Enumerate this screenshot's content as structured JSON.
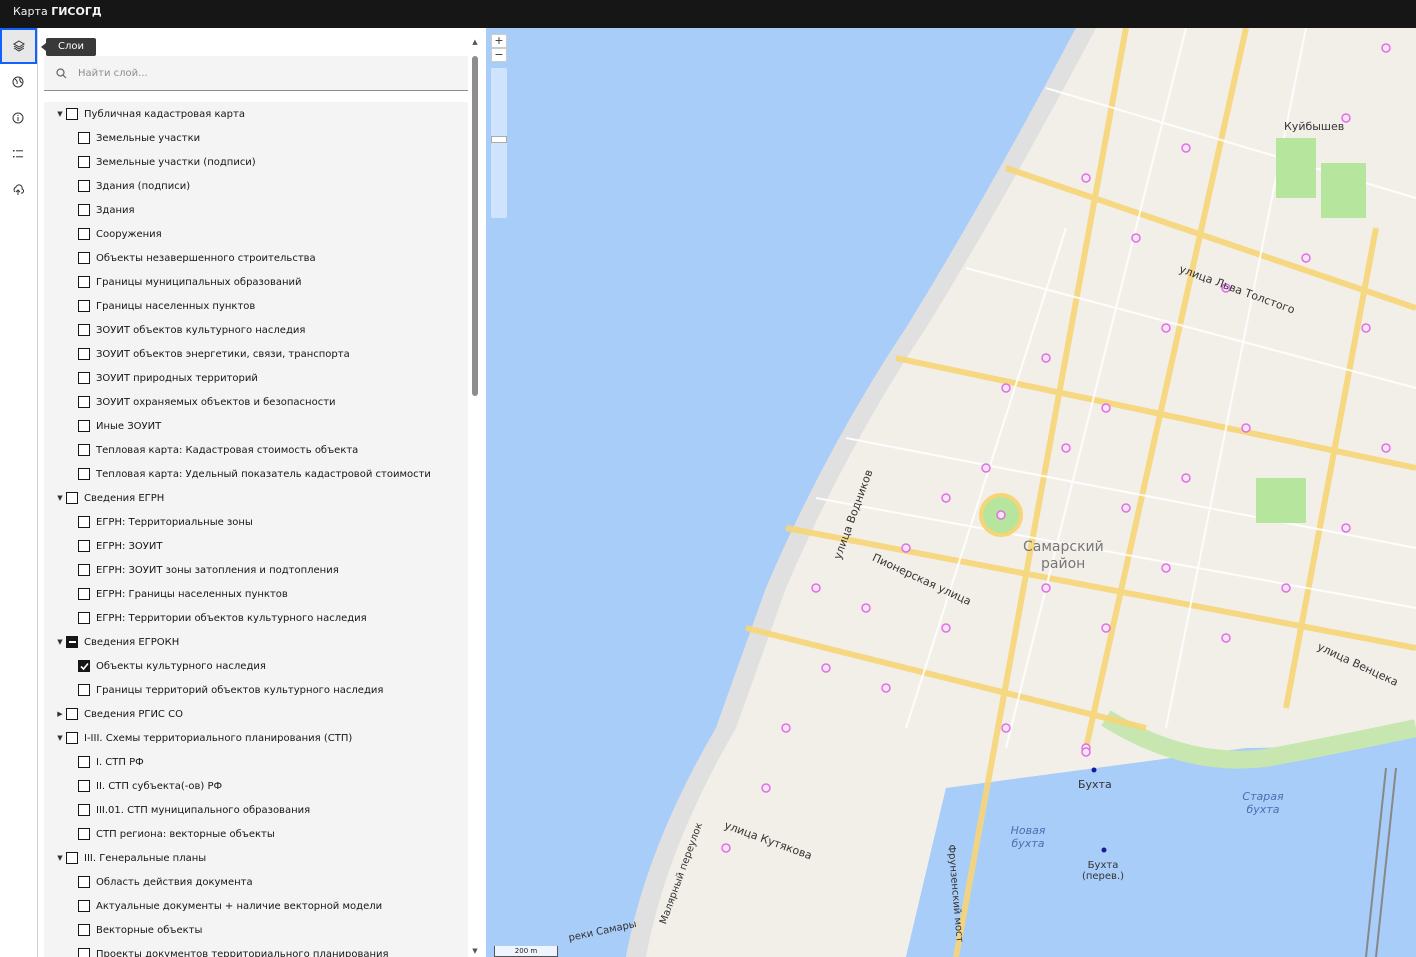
{
  "app": {
    "title_prefix": "Карта",
    "title_name": "ГИСОГД"
  },
  "rail": {
    "tooltip": "Слои",
    "items": [
      {
        "name": "layers-icon"
      },
      {
        "name": "globe-icon"
      },
      {
        "name": "info-icon"
      },
      {
        "name": "list-icon"
      },
      {
        "name": "upload-icon"
      }
    ]
  },
  "search": {
    "placeholder": "Найти слой..."
  },
  "tree": [
    {
      "label": "Публичная кадастровая карта",
      "level": 0,
      "expanded": true,
      "state": "unchecked"
    },
    {
      "label": "Земельные участки",
      "level": 1,
      "state": "unchecked"
    },
    {
      "label": "Земельные участки (подписи)",
      "level": 1,
      "state": "unchecked"
    },
    {
      "label": "Здания (подписи)",
      "level": 1,
      "state": "unchecked"
    },
    {
      "label": "Здания",
      "level": 1,
      "state": "unchecked"
    },
    {
      "label": "Сооружения",
      "level": 1,
      "state": "unchecked"
    },
    {
      "label": "Объекты незавершенного строительства",
      "level": 1,
      "state": "unchecked"
    },
    {
      "label": "Границы муниципальных образований",
      "level": 1,
      "state": "unchecked"
    },
    {
      "label": "Границы населенных пунктов",
      "level": 1,
      "state": "unchecked"
    },
    {
      "label": "ЗОУИТ объектов культурного наследия",
      "level": 1,
      "state": "unchecked"
    },
    {
      "label": "ЗОУИТ объектов энергетики, связи, транспорта",
      "level": 1,
      "state": "unchecked"
    },
    {
      "label": "ЗОУИТ природных территорий",
      "level": 1,
      "state": "unchecked"
    },
    {
      "label": "ЗОУИТ охраняемых объектов и безопасности",
      "level": 1,
      "state": "unchecked"
    },
    {
      "label": "Иные ЗОУИТ",
      "level": 1,
      "state": "unchecked"
    },
    {
      "label": "Тепловая карта: Кадастровая стоимость объекта",
      "level": 1,
      "state": "unchecked"
    },
    {
      "label": "Тепловая карта: Удельный показатель кадастровой стоимости",
      "level": 1,
      "state": "unchecked"
    },
    {
      "label": "Сведения ЕГРН",
      "level": 0,
      "expanded": true,
      "state": "unchecked"
    },
    {
      "label": "ЕГРН: Территориальные зоны",
      "level": 1,
      "state": "unchecked"
    },
    {
      "label": "ЕГРН: ЗОУИТ",
      "level": 1,
      "state": "unchecked"
    },
    {
      "label": "ЕГРН: ЗОУИТ зоны затопления и подтопления",
      "level": 1,
      "state": "unchecked"
    },
    {
      "label": "ЕГРН: Границы населенных пунктов",
      "level": 1,
      "state": "unchecked"
    },
    {
      "label": "ЕГРН: Территории объектов культурного наследия",
      "level": 1,
      "state": "unchecked"
    },
    {
      "label": "Сведения ЕГРОКН",
      "level": 0,
      "expanded": true,
      "state": "indeterminate"
    },
    {
      "label": "Объекты культурного наследия",
      "level": 1,
      "state": "checked"
    },
    {
      "label": "Границы территорий объектов культурного наследия",
      "level": 1,
      "state": "unchecked"
    },
    {
      "label": "Сведения РГИС СО",
      "level": 0,
      "expanded": false,
      "state": "unchecked"
    },
    {
      "label": "I-III. Схемы территориального планирования (СТП)",
      "level": 0,
      "expanded": true,
      "state": "unchecked"
    },
    {
      "label": "I. СТП РФ",
      "level": 1,
      "state": "unchecked"
    },
    {
      "label": "II. СТП субъекта(-ов) РФ",
      "level": 1,
      "state": "unchecked"
    },
    {
      "label": "III.01. СТП муниципального образования",
      "level": 1,
      "state": "unchecked"
    },
    {
      "label": "СТП региона: векторные объекты",
      "level": 1,
      "state": "unchecked"
    },
    {
      "label": "III. Генеральные планы",
      "level": 0,
      "expanded": true,
      "state": "unchecked"
    },
    {
      "label": "Область действия документа",
      "level": 1,
      "state": "unchecked"
    },
    {
      "label": "Актуальные документы + наличие векторной модели",
      "level": 1,
      "state": "unchecked"
    },
    {
      "label": "Векторные объекты",
      "level": 1,
      "state": "unchecked"
    },
    {
      "label": "Проекты документов территориального планирования",
      "level": 1,
      "state": "unchecked"
    }
  ],
  "map": {
    "zoom_in": "+",
    "zoom_out": "−",
    "scale": "200 m",
    "labels": [
      {
        "text": "Куйбышев",
        "cls": "lbl-a"
      },
      {
        "text": "улица Льва Толстого",
        "cls": "lbl-b"
      },
      {
        "text": "Самарский",
        "cls": "lbl-c"
      },
      {
        "text": "район",
        "cls": "lbl-d"
      },
      {
        "text": "улица Водников",
        "cls": "lbl-e"
      },
      {
        "text": "Пионерская улица",
        "cls": "lbl-f"
      },
      {
        "text": "улица Венцека",
        "cls": "lbl-g"
      },
      {
        "text": "Бухта",
        "cls": "lbl-h"
      },
      {
        "text": "Бухта (перев.)",
        "cls": "lbl-i"
      },
      {
        "text": "Старая бухта",
        "cls": "lbl-j"
      },
      {
        "text": "Новая бухта",
        "cls": "lbl-k"
      },
      {
        "text": "улица Кутякова",
        "cls": "lbl-l"
      },
      {
        "text": "Фрунзенский мост",
        "cls": "lbl-m"
      },
      {
        "text": "Малярный переулок",
        "cls": "lbl-n"
      },
      {
        "text": "реки Самары",
        "cls": "lbl-o"
      }
    ]
  }
}
